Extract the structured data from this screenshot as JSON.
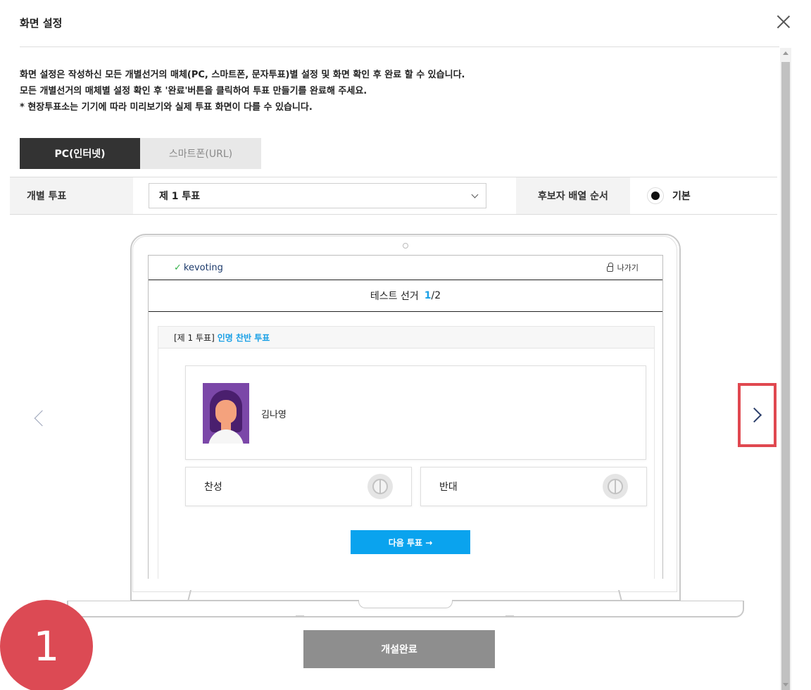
{
  "modal": {
    "title": "화면 설정"
  },
  "notice": {
    "line1": "화면 설정은 작성하신 모든 개별선거의 매체(PC, 스마트폰, 문자투표)별 설정 및 화면 확인 후 완료 할 수 있습니다.",
    "line2": "모든 개별선거의 매체별 설정 확인 후 '완료'버튼을 클릭하여 투표 만들기를 완료해 주세요.",
    "line3": "* 현장투표소는 기기에 따라 미리보기와 실제 투표 화면이 다를 수 있습니다."
  },
  "tabs": [
    {
      "label": "PC(인터넷)",
      "active": true
    },
    {
      "label": "스마트폰(URL)",
      "active": false
    }
  ],
  "settings": {
    "vote_label": "개별 투표",
    "vote_selected": "제 1 투표",
    "order_label": "후보자 배열 순서",
    "order_option": "기본"
  },
  "preview": {
    "logo_text": "kevoting",
    "exit_label": "나가기",
    "election_title": "테스트 선거",
    "progress_current": "1",
    "progress_total": "/2",
    "ballot_prefix": "[제 1 투표]",
    "ballot_name": "인명 찬반 투표",
    "candidate_name": "김나영",
    "yes_label": "찬성",
    "no_label": "반대",
    "next_label": "다음 투표 →"
  },
  "footer": {
    "complete_label": "개설완료"
  },
  "annotation": {
    "step_number": "1"
  },
  "colors": {
    "accent_blue": "#0aa3ee",
    "tab_active": "#333333",
    "highlight_red": "#e04850",
    "badge_red": "#dc4a54",
    "complete_gray": "#8e8e8e"
  },
  "icons": {
    "close": "close-icon",
    "chevron_down": "chevron-down-icon",
    "prev": "chevron-left-icon",
    "next": "chevron-right-icon",
    "lock": "lock-icon",
    "stamp": "stamp-icon"
  }
}
